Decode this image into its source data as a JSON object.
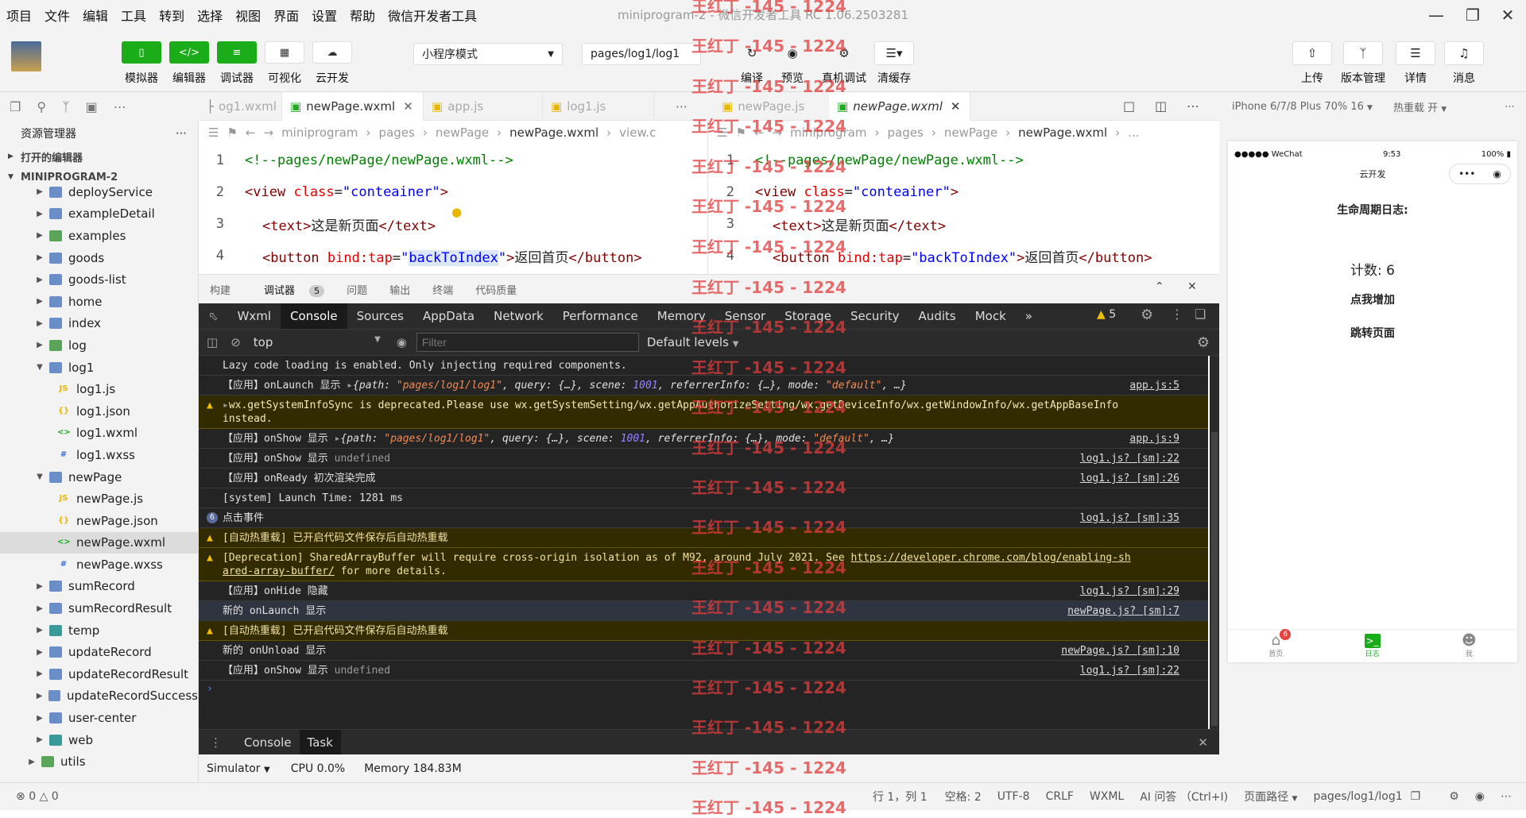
{
  "menu": [
    "项目",
    "文件",
    "编辑",
    "工具",
    "转到",
    "选择",
    "视图",
    "界面",
    "设置",
    "帮助",
    "微信开发者工具"
  ],
  "window_title": "miniprogram-2 - 微信开发者工具 RC 1.06.2503281",
  "toolbar": {
    "simulator": "模拟器",
    "editor": "编辑器",
    "debugger": "调试器",
    "visual": "可视化",
    "cloud": "云开发",
    "mode": "小程序模式",
    "page_path": "pages/log1/log1",
    "compile": "编译",
    "preview": "预览",
    "remote_debug": "真机调试",
    "clear_cache": "清缓存",
    "upload": "上传",
    "version": "版本管理",
    "details": "详情",
    "messages": "消息"
  },
  "explorer": {
    "title": "资源管理器",
    "open_editors": "打开的编辑器",
    "project": "MINIPROGRAM-2",
    "items": [
      {
        "label": "deployService",
        "depth": 1,
        "type": "folder"
      },
      {
        "label": "exampleDetail",
        "depth": 1,
        "type": "folder"
      },
      {
        "label": "examples",
        "depth": 1,
        "type": "folder-green"
      },
      {
        "label": "goods",
        "depth": 1,
        "type": "folder"
      },
      {
        "label": "goods-list",
        "depth": 1,
        "type": "folder"
      },
      {
        "label": "home",
        "depth": 1,
        "type": "folder"
      },
      {
        "label": "index",
        "depth": 1,
        "type": "folder"
      },
      {
        "label": "log",
        "depth": 1,
        "type": "folder-green"
      },
      {
        "label": "log1",
        "depth": 1,
        "type": "folder-open"
      },
      {
        "label": "log1.js",
        "depth": 2,
        "type": "js"
      },
      {
        "label": "log1.json",
        "depth": 2,
        "type": "json"
      },
      {
        "label": "log1.wxml",
        "depth": 2,
        "type": "wxml"
      },
      {
        "label": "log1.wxss",
        "depth": 2,
        "type": "wxss"
      },
      {
        "label": "newPage",
        "depth": 1,
        "type": "folder-open"
      },
      {
        "label": "newPage.js",
        "depth": 2,
        "type": "js"
      },
      {
        "label": "newPage.json",
        "depth": 2,
        "type": "json"
      },
      {
        "label": "newPage.wxml",
        "depth": 2,
        "type": "wxml",
        "selected": true
      },
      {
        "label": "newPage.wxss",
        "depth": 2,
        "type": "wxss"
      },
      {
        "label": "sumRecord",
        "depth": 1,
        "type": "folder"
      },
      {
        "label": "sumRecordResult",
        "depth": 1,
        "type": "folder"
      },
      {
        "label": "temp",
        "depth": 1,
        "type": "folder-teal"
      },
      {
        "label": "updateRecord",
        "depth": 1,
        "type": "folder"
      },
      {
        "label": "updateRecordResult",
        "depth": 1,
        "type": "folder"
      },
      {
        "label": "updateRecordSuccess",
        "depth": 1,
        "type": "folder"
      },
      {
        "label": "user-center",
        "depth": 1,
        "type": "folder"
      },
      {
        "label": "web",
        "depth": 1,
        "type": "folder-teal"
      },
      {
        "label": "utils",
        "depth": 0,
        "type": "folder-green"
      }
    ]
  },
  "editor_left": {
    "tabs": [
      "og1.wxml",
      "newPage.wxml",
      "app.js",
      "log1.js"
    ],
    "breadcrumb": [
      "miniprogram",
      "pages",
      "newPage",
      "newPage.wxml",
      "view.c"
    ]
  },
  "editor_right": {
    "tabs": [
      "newPage.js",
      "newPage.wxml"
    ],
    "breadcrumb": [
      "miniprogram",
      "pages",
      "newPage",
      "newPage.wxml",
      "..."
    ]
  },
  "code": {
    "l1": "<!--pages/newPage/newPage.wxml-->",
    "l2_tag": "view",
    "l2_attr": "class",
    "l2_val": "\"conteainer\"",
    "l3_tag": "text",
    "l3_text": "这是新页面",
    "l4_tag": "button",
    "l4_attr": "bind:tap",
    "l4_val_l": "backToIndex",
    "l4_val_r": "\"backToIndex\"",
    "l4_text": "返回首页"
  },
  "panel_tabs": [
    "构建",
    "调试器",
    "问题",
    "输出",
    "终端",
    "代码质量"
  ],
  "panel_badge": "5",
  "devtools_tabs": [
    "Wxml",
    "Console",
    "Sources",
    "AppData",
    "Network",
    "Performance",
    "Memory",
    "Sensor",
    "Storage",
    "Security",
    "Audits",
    "Mock"
  ],
  "warn_count": "5",
  "filter": {
    "context": "top",
    "placeholder": "Filter",
    "levels": "Default levels"
  },
  "console": {
    "r1": "Lazy code loading is enabled. Only injecting required components.",
    "r2_pre": "【应用】onLaunch 显示 ",
    "r2_obj_a": "{path: ",
    "r2_path": "\"pages/log1/log1\"",
    "r2_obj_b": ", query: {…}, scene: ",
    "r2_scene": "1001",
    "r2_obj_c": ", referrerInfo: {…}, mode: ",
    "r2_mode": "\"default\"",
    "r2_obj_d": ", …}",
    "r2_src": "app.js:5",
    "r3": "wx.getSystemInfoSync is deprecated.Please use wx.getSystemSetting/wx.getAppAuthorizeSetting/wx.getDeviceInfo/wx.getWindowInfo/wx.getAppBaseInfo instead.",
    "r4_pre": "【应用】onShow 显示 ",
    "r4_src": "app.js:9",
    "r5": "【应用】onShow 显示 ",
    "r5_undef": "undefined",
    "r5_src": "log1.js? [sm]:22",
    "r6": "【应用】onReady 初次渲染完成",
    "r6_src": "log1.js? [sm]:26",
    "r7": "[system] Launch Time: 1281 ms",
    "r8_badge": "6",
    "r8": "点击事件",
    "r8_src": "log1.js? [sm]:35",
    "r9": "[自动热重载] 已开启代码文件保存后自动热重载",
    "r10_a": "[Deprecation] SharedArrayBuffer will require cross-origin isolation as of M92, around July 2021. See ",
    "r10_link1": "https://developer.chrome.com/blog/enabling-sh",
    "r10_link2": "ared-array-buffer/",
    "r10_b": " for more details.",
    "r11": "【应用】onHide 隐藏",
    "r11_src": "log1.js? [sm]:29",
    "r12": "新的 onLaunch 显示",
    "r12_src": "newPage.js? [sm]:7",
    "r13": "[自动热重载] 已开启代码文件保存后自动热重载",
    "r14": "新的 onUnload 显示",
    "r14_src": "newPage.js? [sm]:10",
    "r15": "【应用】onShow 显示 ",
    "r15_undef": "undefined",
    "r15_src": "log1.js? [sm]:22"
  },
  "drawer": {
    "console": "Console",
    "task": "Task"
  },
  "sim_status": {
    "sim": "Simulator",
    "cpu": "CPU 0.0%",
    "mem": "Memory 184.83M"
  },
  "simulator": {
    "device": "iPhone 6/7/8 Plus 70% 16",
    "hot_reload": "热重载 开",
    "carrier": "●●●●● WeChat",
    "time": "9:53",
    "battery": "100%",
    "nav_title": "云开发",
    "heading": "生命周期日志:",
    "count": "计数: 6",
    "btn_inc": "点我增加",
    "btn_jump": "跳转页面",
    "tab_home": "首页",
    "tab_home_badge": "6",
    "tab_log": "日志",
    "tab_me": "我"
  },
  "statusbar": {
    "errors": "0",
    "warnings": "0",
    "pos": "行 1，列 1",
    "spaces": "空格: 2",
    "enc": "UTF-8",
    "eol": "CRLF",
    "lang": "WXML",
    "ai": "AI 问答 （Ctrl+I)",
    "page_path_label": "页面路径",
    "page_path": "pages/log1/log1"
  },
  "watermark": "王红丁 -145 - 1224",
  "colors": {
    "green": "#1aad19",
    "warn_bg": "#332b00",
    "console_bg": "#242424"
  }
}
